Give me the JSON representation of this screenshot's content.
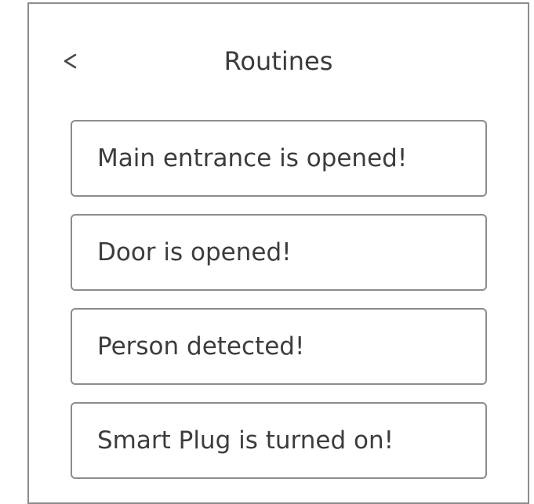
{
  "header": {
    "back_icon": "chevron-left-icon",
    "back_label": "<",
    "title": "Routines"
  },
  "routines": [
    {
      "label": "Main entrance is opened!"
    },
    {
      "label": "Door is opened!"
    },
    {
      "label": "Person detected!"
    },
    {
      "label": "Smart Plug is turned on!"
    }
  ],
  "colors": {
    "border": "#8c8c8c",
    "text": "#3c3c3c",
    "background": "#ffffff"
  }
}
